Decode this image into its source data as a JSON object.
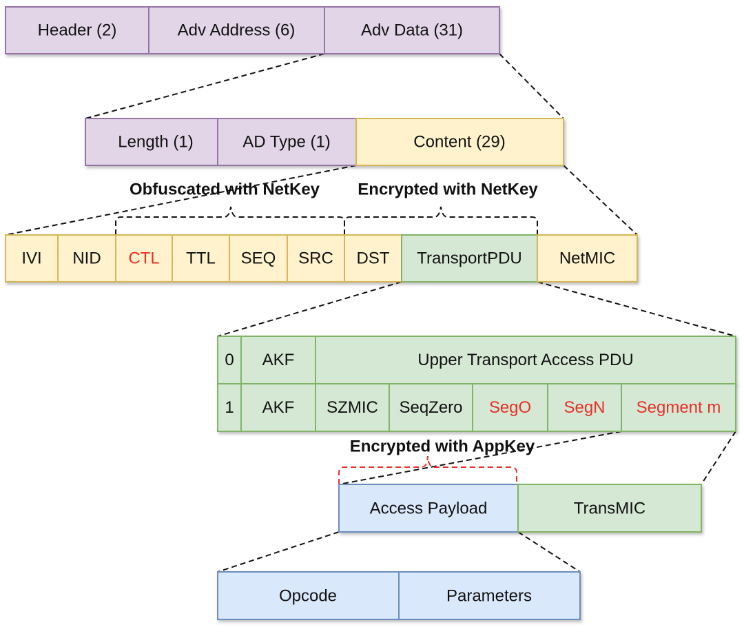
{
  "adv_packet": [
    "Header (2)",
    "Adv Address (6)",
    "Adv Data (31)"
  ],
  "ad_structure": [
    "Length (1)",
    "AD Type (1)",
    "Content (29)"
  ],
  "annotations": {
    "obfuscated": "Obfuscated with NetKey",
    "encrypted_netkey": "Encrypted with NetKey",
    "encrypted_appkey": "Encrypted with AppKey"
  },
  "network_pdu": [
    "IVI",
    "NID",
    "CTL",
    "TTL",
    "SEQ",
    "SRC",
    "DST",
    "TransportPDU",
    "NetMIC"
  ],
  "transport_unsegmented": [
    "0",
    "AKF",
    "Upper Transport Access PDU"
  ],
  "transport_segmented": [
    "1",
    "AKF",
    "SZMIC",
    "SeqZero",
    "SegO",
    "SegN",
    "Segment m"
  ],
  "upper_transport": [
    "Access Payload",
    "TransMIC"
  ],
  "access_payload": [
    "Opcode",
    "Parameters"
  ],
  "colors": {
    "purple_fill": "#e1d5e7",
    "yellow_fill": "#fff2cc",
    "green_fill": "#d5e8d4",
    "blue_fill": "#dae8fc",
    "highlight_red": "#e8302a"
  }
}
